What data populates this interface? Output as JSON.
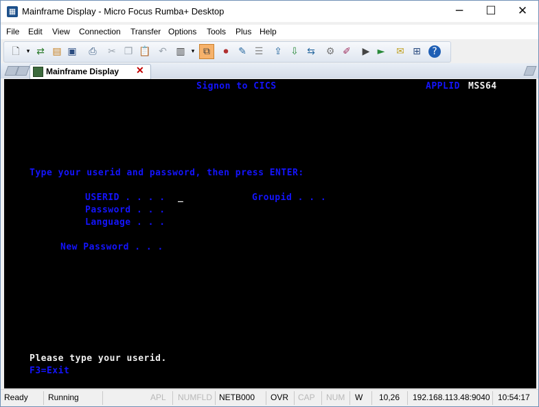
{
  "window": {
    "title": "Mainframe Display - Micro Focus Rumba+ Desktop",
    "controls": {
      "minimize": "─",
      "maximize": "☐",
      "close": "✕"
    }
  },
  "menu": [
    "File",
    "Edit",
    "View",
    "Connection",
    "Transfer",
    "Options",
    "Tools",
    "Plus",
    "Help"
  ],
  "toolbar": {
    "icons": [
      "new-session",
      "dropdown",
      "connect",
      "open",
      "save",
      "print",
      "cut",
      "copy",
      "paste",
      "undo",
      "layout",
      "dropdown",
      "toggle-view",
      "record-macro",
      "edit-macro",
      "macro-list",
      "send-file",
      "receive-file",
      "transfer",
      "settings",
      "keyboard-map",
      "run-macro",
      "play",
      "notes",
      "network",
      "help"
    ]
  },
  "tab": {
    "label": "Mainframe Display",
    "close": "✕"
  },
  "terminal": {
    "header_title": "Signon to CICS",
    "applid_label": "APPLID",
    "applid_value": "MSS64",
    "instruction": "Type your userid and password, then press ENTER:",
    "userid_label": "USERID . . . .",
    "cursor": "_",
    "groupid_label": "Groupid . . .",
    "password_label": "Password . . .",
    "language_label": "Language . . .",
    "new_password_label": "New Password . . .",
    "message": "Please type your userid.",
    "pf_keys": "F3=Exit"
  },
  "status": {
    "ready": "Ready",
    "running": "Running",
    "apl": "APL",
    "numfld": "NUMFLD",
    "device": "NETB000",
    "ovr": "OVR",
    "cap": "CAP",
    "num": "NUM",
    "mode": "W",
    "cursor_pos": "10,26",
    "host": "192.168.113.48:9040",
    "time": "10:54:17"
  },
  "colors": {
    "terminal_bg": "#000000",
    "field_blue": "#1414ff",
    "field_white": "#f0f0f0",
    "tab_close": "#c00000"
  }
}
